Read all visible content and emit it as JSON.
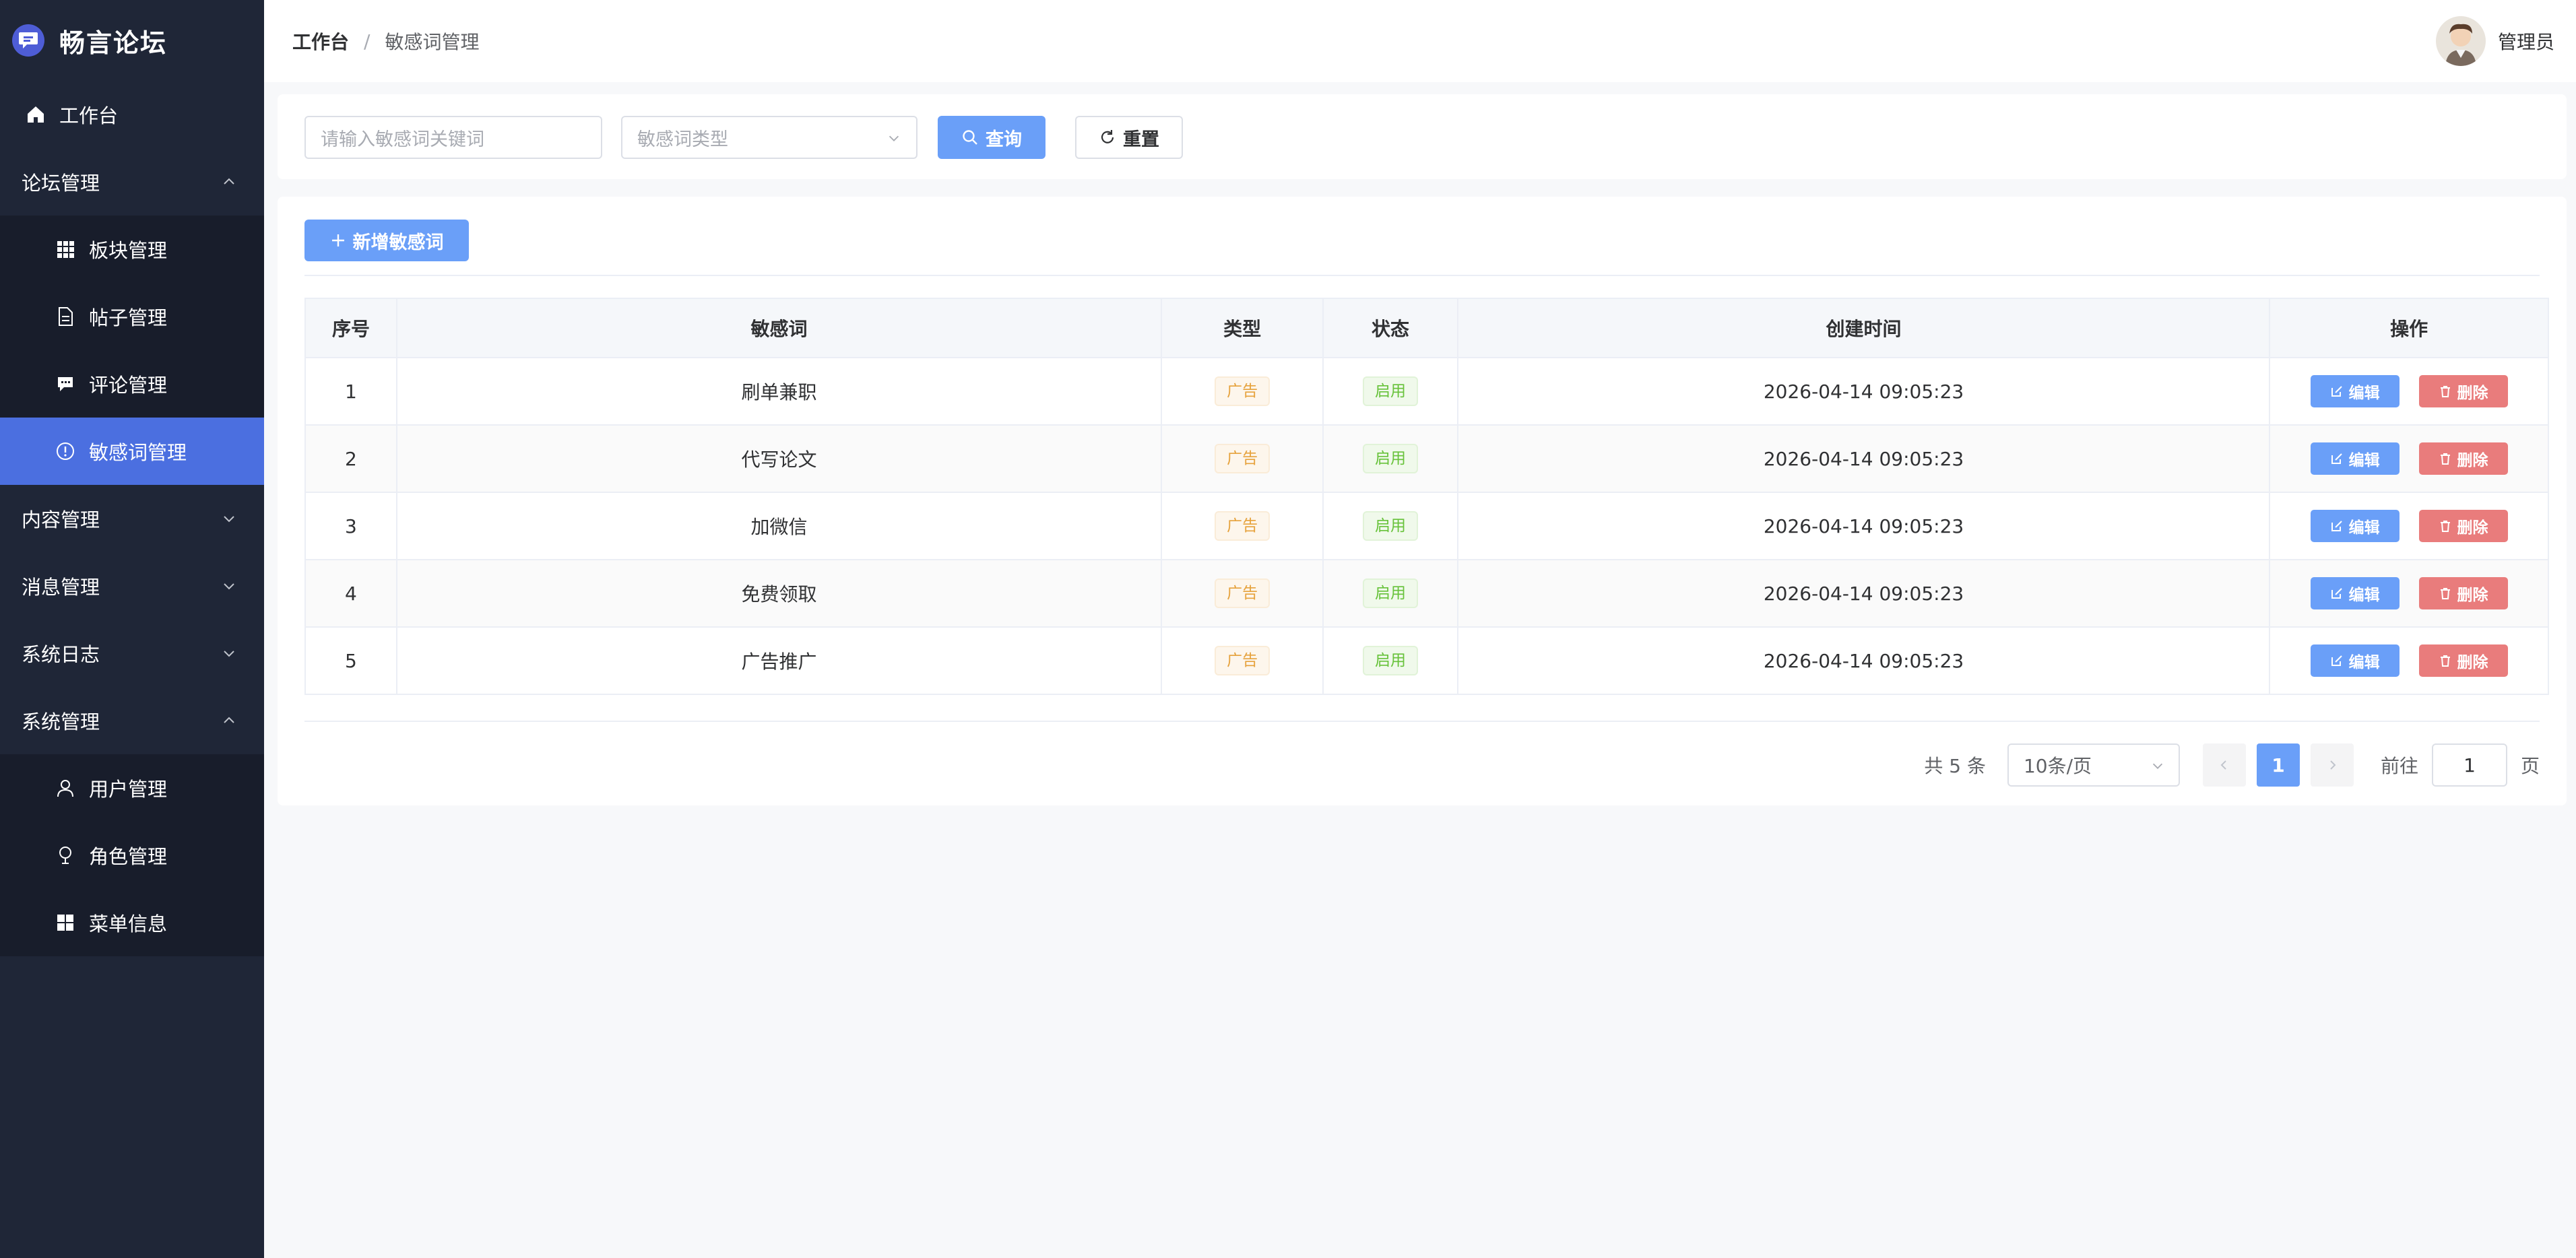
{
  "app": {
    "title": "畅言论坛"
  },
  "sidebar": {
    "dashboard": "工作台",
    "forum_group": "论坛管理",
    "forum_items": [
      "板块管理",
      "帖子管理",
      "评论管理",
      "敏感词管理"
    ],
    "content_group": "内容管理",
    "message_group": "消息管理",
    "log_group": "系统日志",
    "system_group": "系统管理",
    "system_items": [
      "用户管理",
      "角色管理",
      "菜单信息"
    ],
    "active_color": "#4b6fe0"
  },
  "header": {
    "breadcrumb_home": "工作台",
    "breadcrumb_sep": "/",
    "breadcrumb_current": "敏感词管理",
    "user_name": "管理员"
  },
  "search": {
    "keyword_placeholder": "请输入敏感词关键词",
    "type_placeholder": "敏感词类型",
    "query_label": "查询",
    "reset_label": "重置"
  },
  "toolbar": {
    "add_label": "新增敏感词"
  },
  "table": {
    "columns": [
      "序号",
      "敏感词",
      "类型",
      "状态",
      "创建时间",
      "操作"
    ],
    "rows": [
      {
        "index": "1",
        "word": "刷单兼职",
        "type": "广告",
        "status": "启用",
        "created": "2026-04-14 09:05:23"
      },
      {
        "index": "2",
        "word": "代写论文",
        "type": "广告",
        "status": "启用",
        "created": "2026-04-14 09:05:23"
      },
      {
        "index": "3",
        "word": "加微信",
        "type": "广告",
        "status": "启用",
        "created": "2026-04-14 09:05:23"
      },
      {
        "index": "4",
        "word": "免费领取",
        "type": "广告",
        "status": "启用",
        "created": "2026-04-14 09:05:23"
      },
      {
        "index": "5",
        "word": "广告推广",
        "type": "广告",
        "status": "启用",
        "created": "2026-04-14 09:05:23"
      }
    ],
    "edit_label": "编辑",
    "delete_label": "删除"
  },
  "pagination": {
    "total": "共 5 条",
    "page_size": "10条/页",
    "current_page": "1",
    "goto_label": "前往",
    "goto_value": "1",
    "page_suffix": "页"
  }
}
